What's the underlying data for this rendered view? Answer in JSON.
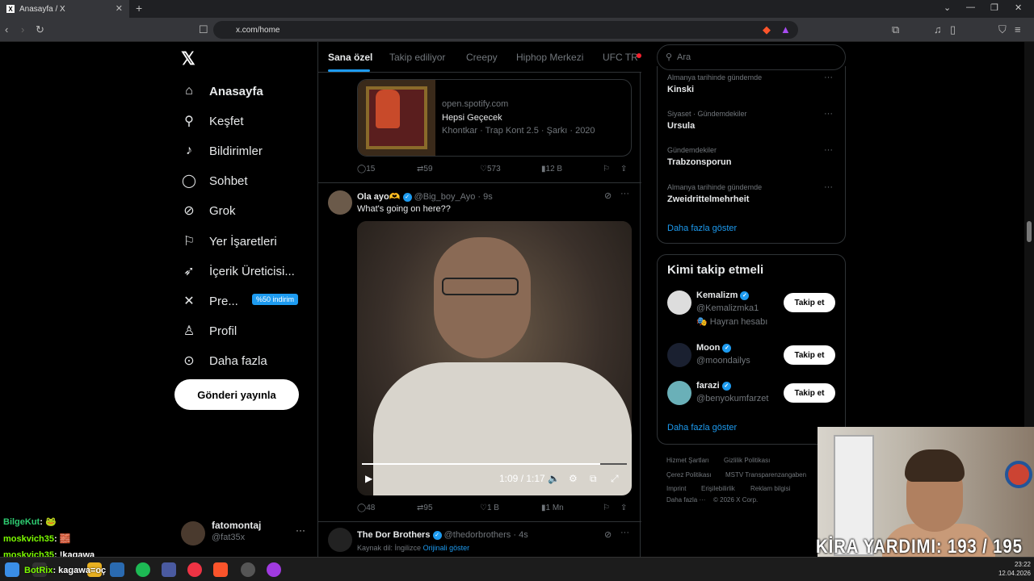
{
  "browser": {
    "tab_title": "Anasayfa / X",
    "url": "x.com/home",
    "new_tab": "+",
    "tab_close": "✕"
  },
  "nav": {
    "items": [
      {
        "label": "Anasayfa",
        "icon": "home-icon"
      },
      {
        "label": "Keşfet",
        "icon": "search-icon"
      },
      {
        "label": "Bildirimler",
        "icon": "bell-icon"
      },
      {
        "label": "Sohbet",
        "icon": "chat-icon"
      },
      {
        "label": "Grok",
        "icon": "grok-icon"
      },
      {
        "label": "Yer İşaretleri",
        "icon": "bookmark-icon"
      },
      {
        "label": "İçerik Üreticisi...",
        "icon": "rocket-icon"
      },
      {
        "label": "Pre...",
        "icon": "x-icon"
      },
      {
        "label": "Profil",
        "icon": "user-icon"
      },
      {
        "label": "Daha fazla",
        "icon": "more-icon"
      }
    ],
    "premium_badge": "%50 indirim",
    "post_button": "Gönderi yayınla",
    "account_name": "fatomontaj",
    "account_handle": "@fat35x",
    "account_more": "···"
  },
  "feed": {
    "tabs": [
      "Sana özel",
      "Takip ediliyor",
      "Creepy",
      "Hiphop Merkezi",
      "UFC TR"
    ],
    "spotify_card": {
      "domain": "open.spotify.com",
      "title": "Hepsi Geçecek",
      "meta": "Khontkar · Trap Kont 2.5 · Şarkı · 2020"
    },
    "post1_actions": {
      "replies": "15",
      "reposts": "59",
      "likes": "573",
      "views": "12 B"
    },
    "post2": {
      "name": "Ola ayo🫶",
      "handle": "@Big_boy_Ayo",
      "time": "· 9s",
      "text": "What's going on here??",
      "video_time": "1:09 / 1:17",
      "actions": {
        "replies": "48",
        "reposts": "95",
        "likes": "1 B",
        "views": "1 Mn"
      }
    },
    "post3": {
      "name": "The Dor Brothers",
      "handle": "@thedorbrothers",
      "time": "· 4s",
      "translation_note": "Kaynak dil: İngilizce",
      "original_link": "Orijinali göster"
    }
  },
  "right": {
    "search_placeholder": "Ara",
    "trends": [
      {
        "category": "Almanya tarihinde gündemde",
        "name": "Kinski"
      },
      {
        "category": "Siyaset · Gündemdekiler",
        "name": "Ursula"
      },
      {
        "category": "Gündemdekiler",
        "name": "Trabzonsporun"
      },
      {
        "category": "Almanya tarihinde gündemde",
        "name": "Zweidrittelmehrheit"
      }
    ],
    "trends_more": "Daha fazla göster",
    "who_title": "Kimi takip etmeli",
    "who": [
      {
        "name": "Kemalizm",
        "handle": "@Kemalizmka1",
        "sub": "🎭 Hayran hesabı",
        "button": "Takip et"
      },
      {
        "name": "Moon",
        "handle": "@moondailys",
        "button": "Takip et"
      },
      {
        "name": "farazi",
        "handle": "@benyokumfarzet",
        "button": "Takip et"
      }
    ],
    "who_more": "Daha fazla göster",
    "footer": [
      "Hizmet Şartları",
      "Gizlilik Politikası",
      "Çerez Politikası",
      "MSTV Transparenzangaben",
      "Imprint",
      "Erişilebilirlik",
      "Reklam bilgisi",
      "Daha fazla ···",
      "© 2026 X Corp."
    ]
  },
  "stream": {
    "kira_label": "KİRA YARDIMI:",
    "kira_value": "193 / 195",
    "chat": [
      {
        "user": "BilgeKut",
        "msg": ": 🐸",
        "color": "#2ecc71"
      },
      {
        "user": "moskvich35",
        "msg": ": 🧱",
        "color": "#7cfc00"
      },
      {
        "user": "moskvich35",
        "msg": ": !kagawa",
        "color": "#7cfc00"
      },
      {
        "user": "BotRix",
        "msg": ": kagawa=oç",
        "color": "#7cfc00"
      }
    ]
  },
  "taskbar": {
    "time": "23:22",
    "date": "12.04.2026"
  },
  "colors": {
    "accent": "#1d9bf0",
    "bg": "#000000",
    "border": "#2f3336",
    "muted": "#71767b"
  }
}
